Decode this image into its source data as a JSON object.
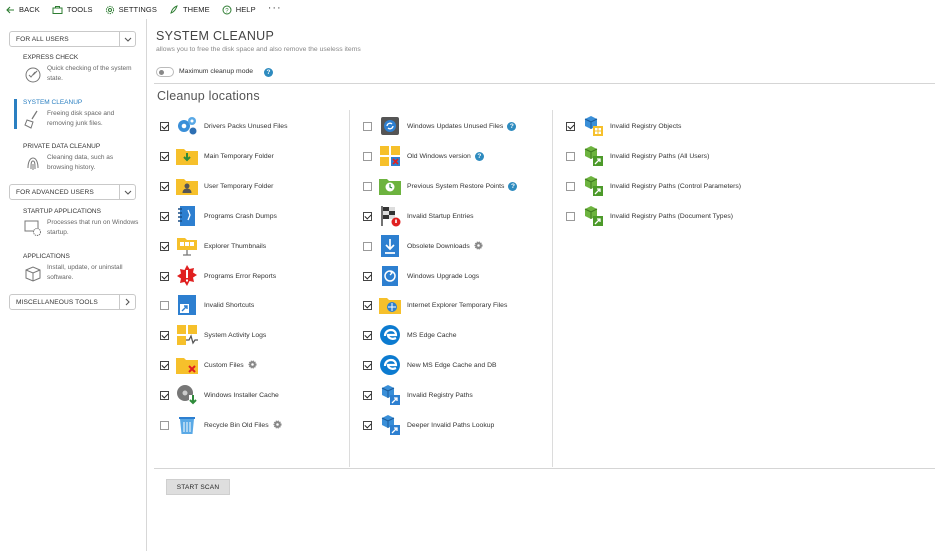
{
  "toolbar": {
    "back": "BACK",
    "tools": "TOOLS",
    "settings": "SETTINGS",
    "theme": "THEME",
    "help": "HELP",
    "more": "···"
  },
  "sidebar": {
    "for_all_users": "FOR ALL USERS",
    "for_advanced_users": "FOR ADVANCED USERS",
    "misc_tools": "MISCELLANEOUS TOOLS",
    "items": [
      {
        "title": "EXPRESS CHECK",
        "desc": "Quick checking of the system state.",
        "icon": "gauge-icon"
      },
      {
        "title": "SYSTEM CLEANUP",
        "desc": "Freeing disk space and removing junk files.",
        "icon": "broom-icon"
      },
      {
        "title": "PRIVATE DATA CLEANUP",
        "desc": "Cleaning data, such as browsing history.",
        "icon": "fingerprint-icon"
      },
      {
        "title": "STARTUP APPLICATIONS",
        "desc": "Processes that run on Windows startup.",
        "icon": "window-gear-icon"
      },
      {
        "title": "APPLICATIONS",
        "desc": "Install, update, or uninstall software.",
        "icon": "package-icon"
      }
    ]
  },
  "main": {
    "title": "SYSTEM CLEANUP",
    "subtitle": "allows you to free the disk space and also remove the useless items",
    "max_mode_label": "Maximum cleanup mode",
    "locations_title": "Cleanup locations",
    "start_scan": "START SCAN"
  },
  "columns": [
    [
      {
        "label": "Drivers Packs Unused Files",
        "checked": true,
        "icon": "gears-icon"
      },
      {
        "label": "Main Temporary Folder",
        "checked": true,
        "icon": "folder-download-icon"
      },
      {
        "label": "User Temporary Folder",
        "checked": true,
        "icon": "folder-user-icon"
      },
      {
        "label": "Programs Crash Dumps",
        "checked": true,
        "icon": "notebook-icon"
      },
      {
        "label": "Explorer Thumbnails",
        "checked": true,
        "icon": "thumbnails-icon"
      },
      {
        "label": "Programs Error Reports",
        "checked": true,
        "icon": "error-burst-icon"
      },
      {
        "label": "Invalid Shortcuts",
        "checked": false,
        "icon": "shortcut-icon"
      },
      {
        "label": "System Activity Logs",
        "checked": true,
        "icon": "windows-pulse-icon"
      },
      {
        "label": "Custom Files",
        "checked": true,
        "icon": "folder-x-icon",
        "gear": true
      },
      {
        "label": "Windows Installer Cache",
        "checked": true,
        "icon": "disk-download-icon"
      },
      {
        "label": "Recycle Bin Old Files",
        "checked": false,
        "icon": "recycle-bin-icon",
        "gear": true
      }
    ],
    [
      {
        "label": "Windows Updates Unused Files",
        "checked": false,
        "icon": "update-disk-icon",
        "help": true
      },
      {
        "label": "Old Windows version",
        "checked": false,
        "icon": "windows-logo-icon",
        "help": true
      },
      {
        "label": "Previous System Restore Points",
        "checked": false,
        "icon": "restore-folder-icon",
        "help": true
      },
      {
        "label": "Invalid Startup Entries",
        "checked": true,
        "icon": "race-flag-icon"
      },
      {
        "label": "Obsolete Downloads",
        "checked": false,
        "icon": "download-page-icon",
        "gear": true
      },
      {
        "label": "Windows Upgrade Logs",
        "checked": true,
        "icon": "upgrade-log-icon"
      },
      {
        "label": "Internet Explorer Temporary Files",
        "checked": true,
        "icon": "ie-folder-icon"
      },
      {
        "label": "MS Edge Cache",
        "checked": true,
        "icon": "edge-icon"
      },
      {
        "label": "New MS Edge Cache and DB",
        "checked": true,
        "icon": "edge-icon"
      },
      {
        "label": "Invalid Registry Paths",
        "checked": true,
        "icon": "registry-blue-icon"
      },
      {
        "label": "Deeper Invalid Paths Lookup",
        "checked": true,
        "icon": "registry-blue-icon"
      }
    ],
    [
      {
        "label": "Invalid Registry Objects",
        "checked": true,
        "icon": "registry-objects-icon"
      },
      {
        "label": "Invalid Registry Paths (All Users)",
        "checked": false,
        "icon": "registry-green-icon"
      },
      {
        "label": "Invalid Registry Paths (Control Parameters)",
        "checked": false,
        "icon": "registry-green-icon"
      },
      {
        "label": "Invalid Registry Paths (Document Types)",
        "checked": false,
        "icon": "registry-green-icon"
      }
    ]
  ],
  "colors": {
    "accent": "#2a7fc1",
    "help": "#2e8bbf",
    "folder": "#f6c02b",
    "error": "#e02020",
    "registry_green": "#6db33f"
  }
}
